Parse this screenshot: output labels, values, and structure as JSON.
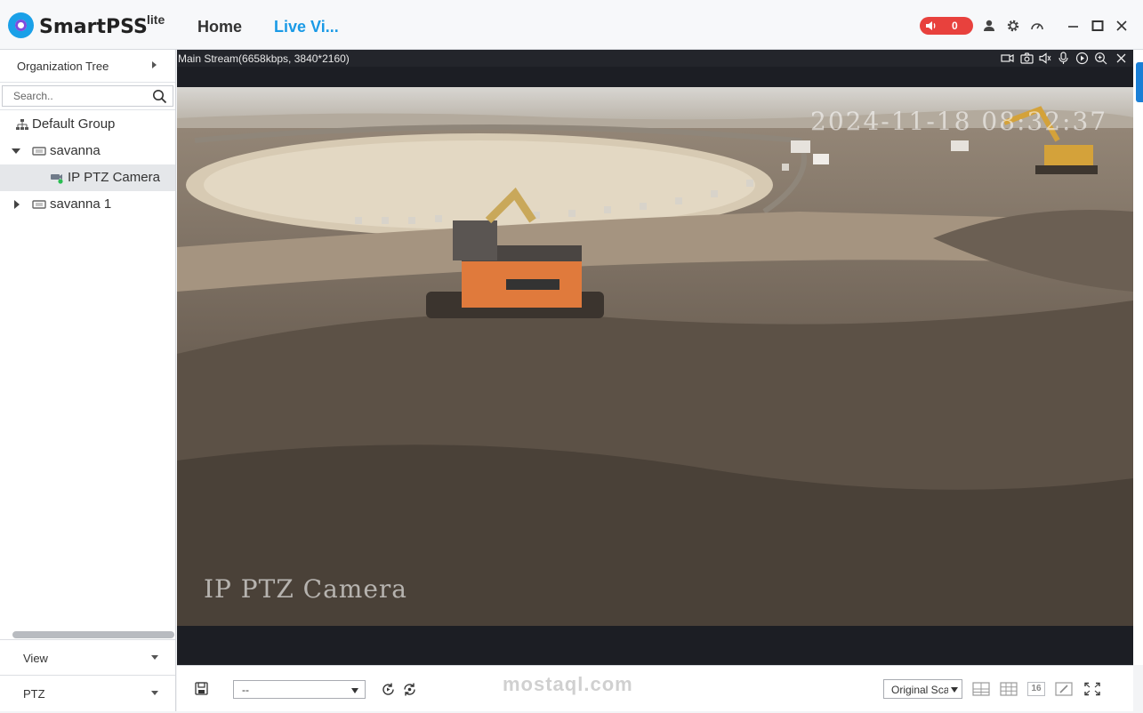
{
  "app": {
    "brand": "SmartPSS",
    "brand_suffix": "lite",
    "tabs": [
      {
        "label": "Home"
      },
      {
        "label": "Live Vi..."
      }
    ],
    "alarm_count": "0",
    "accent_color": "#1a9ae6",
    "alarm_color": "#e8413d"
  },
  "sidebar": {
    "org_tree_label": "Organization Tree",
    "search_placeholder": "Search..",
    "tree": [
      {
        "label": "Default Group"
      },
      {
        "label": "savanna"
      },
      {
        "label": "IP PTZ Camera"
      },
      {
        "label": "savanna 1"
      }
    ],
    "panels": [
      {
        "label": "View"
      },
      {
        "label": "PTZ"
      }
    ]
  },
  "video": {
    "stream_info": "Main Stream(6658kbps, 3840*2160)",
    "osd_timestamp": "2024-11-18 08:32:37",
    "osd_camera_name": "IP PTZ Camera"
  },
  "bottombar": {
    "view_select_value": "--",
    "scale_select_value": "Original Scale",
    "layout_16_label": "16"
  },
  "watermark": "mostaql.com"
}
